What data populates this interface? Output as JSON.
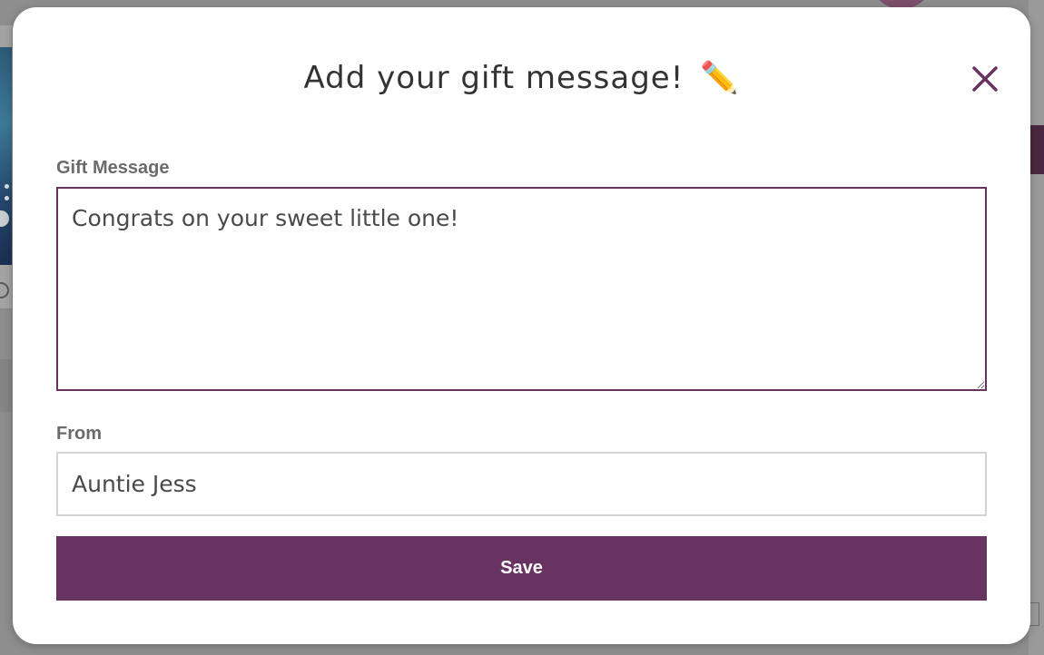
{
  "modal": {
    "title": "Add your gift message!",
    "title_icon": "pencil-icon",
    "title_emoji": "✏️",
    "close_icon": "close-icon",
    "gift_message": {
      "label": "Gift Message",
      "value": "Congrats on your sweet little one! "
    },
    "from": {
      "label": "From",
      "value": "Auntie Jess"
    },
    "save_label": "Save"
  },
  "colors": {
    "accent": "#673360",
    "textarea_border": "#66345f",
    "input_border": "#d4d4d4",
    "title_text": "#333333",
    "label_text": "#6b6b6b"
  }
}
